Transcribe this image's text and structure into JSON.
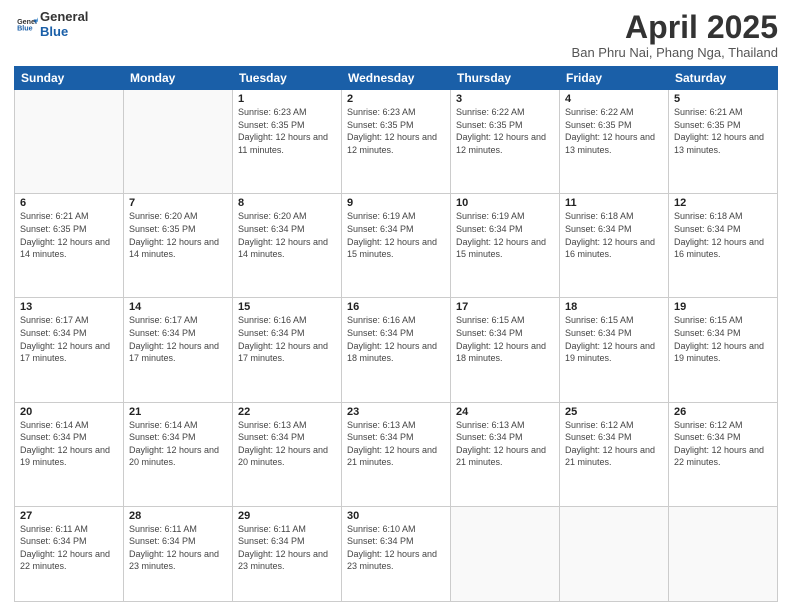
{
  "logo": {
    "general": "General",
    "blue": "Blue"
  },
  "header": {
    "title": "April 2025",
    "subtitle": "Ban Phru Nai, Phang Nga, Thailand"
  },
  "weekdays": [
    "Sunday",
    "Monday",
    "Tuesday",
    "Wednesday",
    "Thursday",
    "Friday",
    "Saturday"
  ],
  "weeks": [
    [
      {
        "day": "",
        "info": ""
      },
      {
        "day": "",
        "info": ""
      },
      {
        "day": "1",
        "info": "Sunrise: 6:23 AM\nSunset: 6:35 PM\nDaylight: 12 hours and 11 minutes."
      },
      {
        "day": "2",
        "info": "Sunrise: 6:23 AM\nSunset: 6:35 PM\nDaylight: 12 hours and 12 minutes."
      },
      {
        "day": "3",
        "info": "Sunrise: 6:22 AM\nSunset: 6:35 PM\nDaylight: 12 hours and 12 minutes."
      },
      {
        "day": "4",
        "info": "Sunrise: 6:22 AM\nSunset: 6:35 PM\nDaylight: 12 hours and 13 minutes."
      },
      {
        "day": "5",
        "info": "Sunrise: 6:21 AM\nSunset: 6:35 PM\nDaylight: 12 hours and 13 minutes."
      }
    ],
    [
      {
        "day": "6",
        "info": "Sunrise: 6:21 AM\nSunset: 6:35 PM\nDaylight: 12 hours and 14 minutes."
      },
      {
        "day": "7",
        "info": "Sunrise: 6:20 AM\nSunset: 6:35 PM\nDaylight: 12 hours and 14 minutes."
      },
      {
        "day": "8",
        "info": "Sunrise: 6:20 AM\nSunset: 6:34 PM\nDaylight: 12 hours and 14 minutes."
      },
      {
        "day": "9",
        "info": "Sunrise: 6:19 AM\nSunset: 6:34 PM\nDaylight: 12 hours and 15 minutes."
      },
      {
        "day": "10",
        "info": "Sunrise: 6:19 AM\nSunset: 6:34 PM\nDaylight: 12 hours and 15 minutes."
      },
      {
        "day": "11",
        "info": "Sunrise: 6:18 AM\nSunset: 6:34 PM\nDaylight: 12 hours and 16 minutes."
      },
      {
        "day": "12",
        "info": "Sunrise: 6:18 AM\nSunset: 6:34 PM\nDaylight: 12 hours and 16 minutes."
      }
    ],
    [
      {
        "day": "13",
        "info": "Sunrise: 6:17 AM\nSunset: 6:34 PM\nDaylight: 12 hours and 17 minutes."
      },
      {
        "day": "14",
        "info": "Sunrise: 6:17 AM\nSunset: 6:34 PM\nDaylight: 12 hours and 17 minutes."
      },
      {
        "day": "15",
        "info": "Sunrise: 6:16 AM\nSunset: 6:34 PM\nDaylight: 12 hours and 17 minutes."
      },
      {
        "day": "16",
        "info": "Sunrise: 6:16 AM\nSunset: 6:34 PM\nDaylight: 12 hours and 18 minutes."
      },
      {
        "day": "17",
        "info": "Sunrise: 6:15 AM\nSunset: 6:34 PM\nDaylight: 12 hours and 18 minutes."
      },
      {
        "day": "18",
        "info": "Sunrise: 6:15 AM\nSunset: 6:34 PM\nDaylight: 12 hours and 19 minutes."
      },
      {
        "day": "19",
        "info": "Sunrise: 6:15 AM\nSunset: 6:34 PM\nDaylight: 12 hours and 19 minutes."
      }
    ],
    [
      {
        "day": "20",
        "info": "Sunrise: 6:14 AM\nSunset: 6:34 PM\nDaylight: 12 hours and 19 minutes."
      },
      {
        "day": "21",
        "info": "Sunrise: 6:14 AM\nSunset: 6:34 PM\nDaylight: 12 hours and 20 minutes."
      },
      {
        "day": "22",
        "info": "Sunrise: 6:13 AM\nSunset: 6:34 PM\nDaylight: 12 hours and 20 minutes."
      },
      {
        "day": "23",
        "info": "Sunrise: 6:13 AM\nSunset: 6:34 PM\nDaylight: 12 hours and 21 minutes."
      },
      {
        "day": "24",
        "info": "Sunrise: 6:13 AM\nSunset: 6:34 PM\nDaylight: 12 hours and 21 minutes."
      },
      {
        "day": "25",
        "info": "Sunrise: 6:12 AM\nSunset: 6:34 PM\nDaylight: 12 hours and 21 minutes."
      },
      {
        "day": "26",
        "info": "Sunrise: 6:12 AM\nSunset: 6:34 PM\nDaylight: 12 hours and 22 minutes."
      }
    ],
    [
      {
        "day": "27",
        "info": "Sunrise: 6:11 AM\nSunset: 6:34 PM\nDaylight: 12 hours and 22 minutes."
      },
      {
        "day": "28",
        "info": "Sunrise: 6:11 AM\nSunset: 6:34 PM\nDaylight: 12 hours and 23 minutes."
      },
      {
        "day": "29",
        "info": "Sunrise: 6:11 AM\nSunset: 6:34 PM\nDaylight: 12 hours and 23 minutes."
      },
      {
        "day": "30",
        "info": "Sunrise: 6:10 AM\nSunset: 6:34 PM\nDaylight: 12 hours and 23 minutes."
      },
      {
        "day": "",
        "info": ""
      },
      {
        "day": "",
        "info": ""
      },
      {
        "day": "",
        "info": ""
      }
    ]
  ]
}
